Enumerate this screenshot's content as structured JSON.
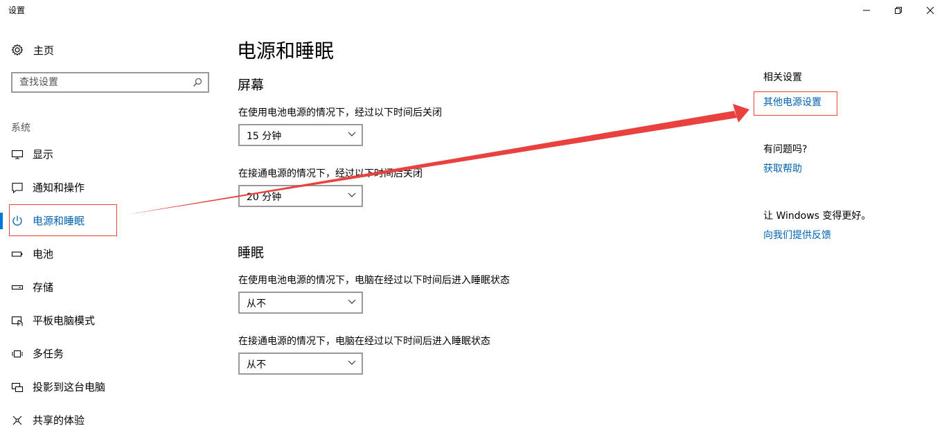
{
  "window": {
    "title": "设置",
    "controls": [
      "minimize-icon",
      "restore-icon",
      "close-icon"
    ]
  },
  "sidebar": {
    "home_label": "主页",
    "search_placeholder": "查找设置",
    "section_label": "系统",
    "items": [
      {
        "label": "显示",
        "icon": "monitor-icon"
      },
      {
        "label": "通知和操作",
        "icon": "notification-icon"
      },
      {
        "label": "电源和睡眠",
        "icon": "power-icon",
        "active": true
      },
      {
        "label": "电池",
        "icon": "battery-icon"
      },
      {
        "label": "存储",
        "icon": "storage-icon"
      },
      {
        "label": "平板电脑模式",
        "icon": "tablet-mode-icon"
      },
      {
        "label": "多任务",
        "icon": "multitasking-icon"
      },
      {
        "label": "投影到这台电脑",
        "icon": "project-icon"
      },
      {
        "label": "共享的体验",
        "icon": "shared-experience-icon"
      }
    ]
  },
  "main": {
    "title": "电源和睡眠",
    "screen": {
      "title": "屏幕",
      "battery_label": "在使用电池电源的情况下，经过以下时间后关闭",
      "battery_value": "15 分钟",
      "plugged_label": "在接通电源的情况下，经过以下时间后关闭",
      "plugged_value": "20 分钟"
    },
    "sleep": {
      "title": "睡眠",
      "battery_label": "在使用电池电源的情况下，电脑在经过以下时间后进入睡眠状态",
      "battery_value": "从不",
      "plugged_label": "在接通电源的情况下，电脑在经过以下时间后进入睡眠状态",
      "plugged_value": "从不"
    }
  },
  "related": {
    "heading": "相关设置",
    "link": "其他电源设置",
    "question_heading": "有问题吗?",
    "help_link": "获取帮助",
    "feedback_heading": "让 Windows 变得更好。",
    "feedback_link": "向我们提供反馈"
  },
  "colors": {
    "accent": "#0078d7",
    "link": "#0063b1",
    "annotation": "#e8413e"
  }
}
